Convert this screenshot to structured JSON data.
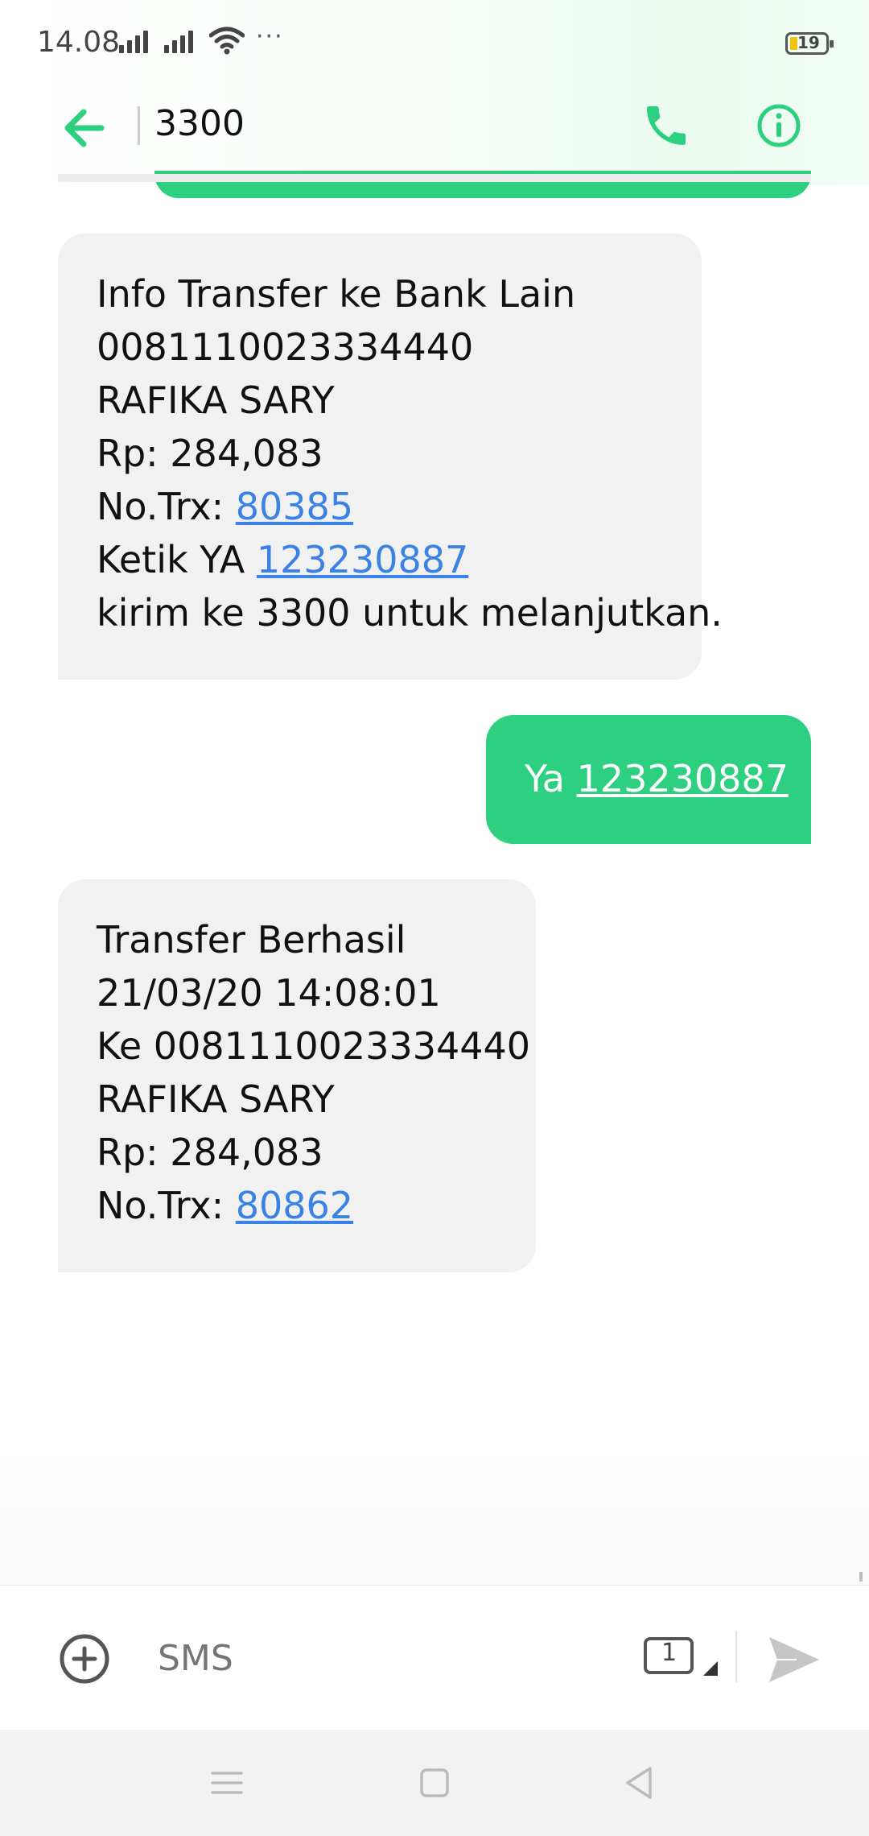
{
  "status_bar": {
    "time": "14.08",
    "more": "···",
    "battery_level": "19"
  },
  "header": {
    "title": "3300",
    "back_icon": "arrow-left-icon",
    "call_icon": "phone-icon",
    "info_icon": "info-icon"
  },
  "messages": [
    {
      "direction": "incoming",
      "lines": [
        "Info Transfer ke Bank Lain",
        "0081110023334440",
        "RAFIKA SARY",
        "Rp: 284,083"
      ],
      "trx_prefix": "No.Trx: ",
      "trx_link": "80385",
      "ketik_prefix": "Ketik YA ",
      "ketik_link": "123230887",
      "last_line": "kirim ke 3300 untuk melanjutkan."
    },
    {
      "direction": "outgoing",
      "prefix": "Ya ",
      "link": "123230887"
    },
    {
      "direction": "incoming",
      "lines": [
        "Transfer Berhasil",
        "21/03/20 14:08:01",
        "Ke 0081110023334440",
        "RAFIKA SARY",
        "Rp: 284,083"
      ],
      "trx_prefix": "No.Trx: ",
      "trx_link": "80862"
    }
  ],
  "compose": {
    "placeholder": "SMS",
    "sim_number": "1"
  },
  "colors": {
    "accent": "#2dcf80",
    "link": "#3b82e6",
    "incoming_bubble": "#f1f1f1"
  }
}
